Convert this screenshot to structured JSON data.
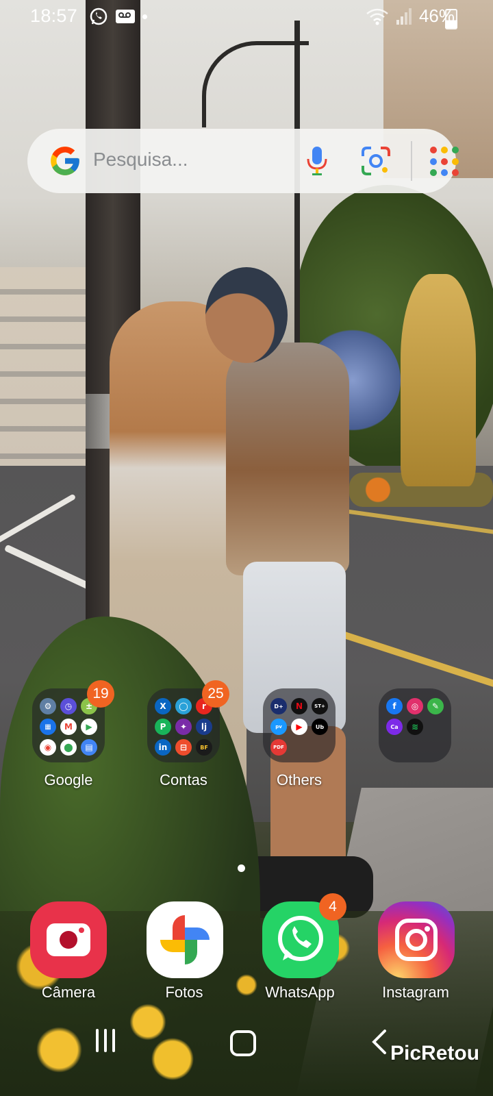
{
  "status_bar": {
    "time": "18:57",
    "battery": "46%",
    "icons_left": [
      "whatsapp-icon",
      "voicemail-icon",
      "dot"
    ],
    "icons_right": [
      "wifi-icon",
      "signal-icon",
      "battery-icon"
    ]
  },
  "search": {
    "placeholder": "Pesquisa...",
    "icons": [
      "google-g-icon",
      "mic-icon",
      "google-lens-icon",
      "apps-dots-icon"
    ]
  },
  "folders": [
    {
      "label": "Google",
      "badge": "19"
    },
    {
      "label": "Contas",
      "badge": "25"
    },
    {
      "label": "Others",
      "badge": ""
    },
    {
      "label": "",
      "badge": ""
    }
  ],
  "dock": [
    {
      "label": "Câmera",
      "badge": ""
    },
    {
      "label": "Fotos",
      "badge": ""
    },
    {
      "label": "WhatsApp",
      "badge": "4"
    },
    {
      "label": "Instagram",
      "badge": ""
    }
  ],
  "watermark": "PicRetou",
  "colors": {
    "badge": "#f06422",
    "camera": "#e8324a",
    "whatsapp": "#25d366",
    "search_bg": "#f4f4f2"
  }
}
